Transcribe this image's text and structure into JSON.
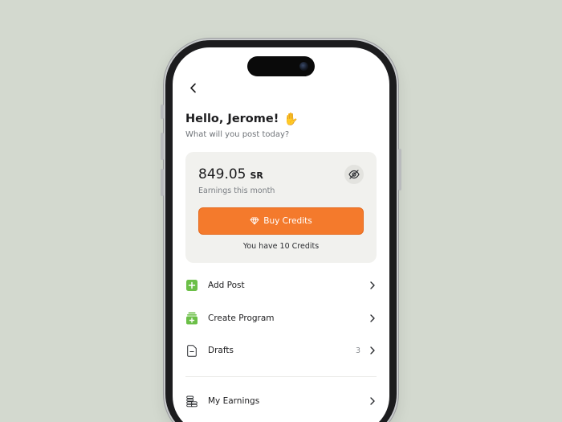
{
  "header": {
    "greeting": "Hello, Jerome!",
    "greeting_emoji": "✋",
    "subtitle": "What will you post today?"
  },
  "earnings_card": {
    "amount": "849.05",
    "currency": "SR",
    "label": "Earnings this month",
    "buy_label": "Buy Credits",
    "credits_text": "You have 10 Credits"
  },
  "menu": {
    "items": [
      {
        "label": "Add Post",
        "icon": "add-square-icon",
        "count": ""
      },
      {
        "label": "Create Program",
        "icon": "program-stack-icon",
        "count": ""
      },
      {
        "label": "Drafts",
        "icon": "draft-doc-icon",
        "count": "3"
      },
      {
        "label": "My Earnings",
        "icon": "coins-stack-icon",
        "count": ""
      }
    ]
  },
  "colors": {
    "accent": "#f47a2c",
    "green": "#6bbf47",
    "background": "#d3d9cf",
    "card": "#f1f1ee"
  }
}
